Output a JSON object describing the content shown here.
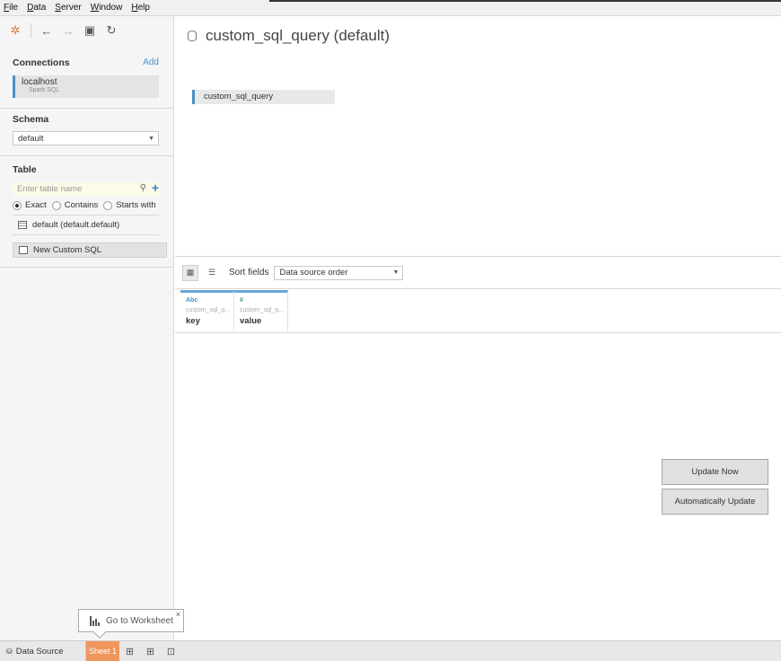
{
  "menu": {
    "items": [
      {
        "key": "F",
        "rest": "ile"
      },
      {
        "key": "D",
        "rest": "ata"
      },
      {
        "key": "S",
        "rest": "erver"
      },
      {
        "key": "W",
        "rest": "indow"
      },
      {
        "key": "H",
        "rest": "elp"
      }
    ]
  },
  "toolbar": {
    "icons": [
      "tableau-logo-icon",
      "back-arrow-icon",
      "forward-arrow-icon",
      "save-icon",
      "refresh-icon"
    ]
  },
  "sidebar": {
    "connections_title": "Connections",
    "add_label": "Add",
    "connection": {
      "name": "localhost",
      "type": "Spark SQL"
    },
    "schema_title": "Schema",
    "schema_value": "default",
    "table_title": "Table",
    "table_search_placeholder": "Enter table name",
    "match_options": {
      "exact": "Exact",
      "contains": "Contains",
      "starts_with": "Starts with",
      "selected": "Exact"
    },
    "tables": [
      {
        "label": "default (default.default)"
      }
    ],
    "custom_sql_label": "New Custom SQL"
  },
  "main": {
    "title": "custom_sql_query (default)",
    "canvas_items": [
      {
        "label": "custom_sql_query"
      }
    ],
    "sort_label": "Sort fields",
    "sort_value": "Data source order",
    "fields": [
      {
        "type": "Abc",
        "source": "custom_sql_q...",
        "name": "key"
      },
      {
        "type": "#",
        "source": "custom_sql_q...",
        "name": "value"
      }
    ],
    "update_now_label": "Update Now",
    "auto_update_label": "Automatically Update"
  },
  "tooltip": {
    "label": "Go to Worksheet",
    "close": "×"
  },
  "bottom": {
    "datasource_tab": "Data Source",
    "sheet_tab": "Sheet 1",
    "accent_color": "#f0965c"
  }
}
